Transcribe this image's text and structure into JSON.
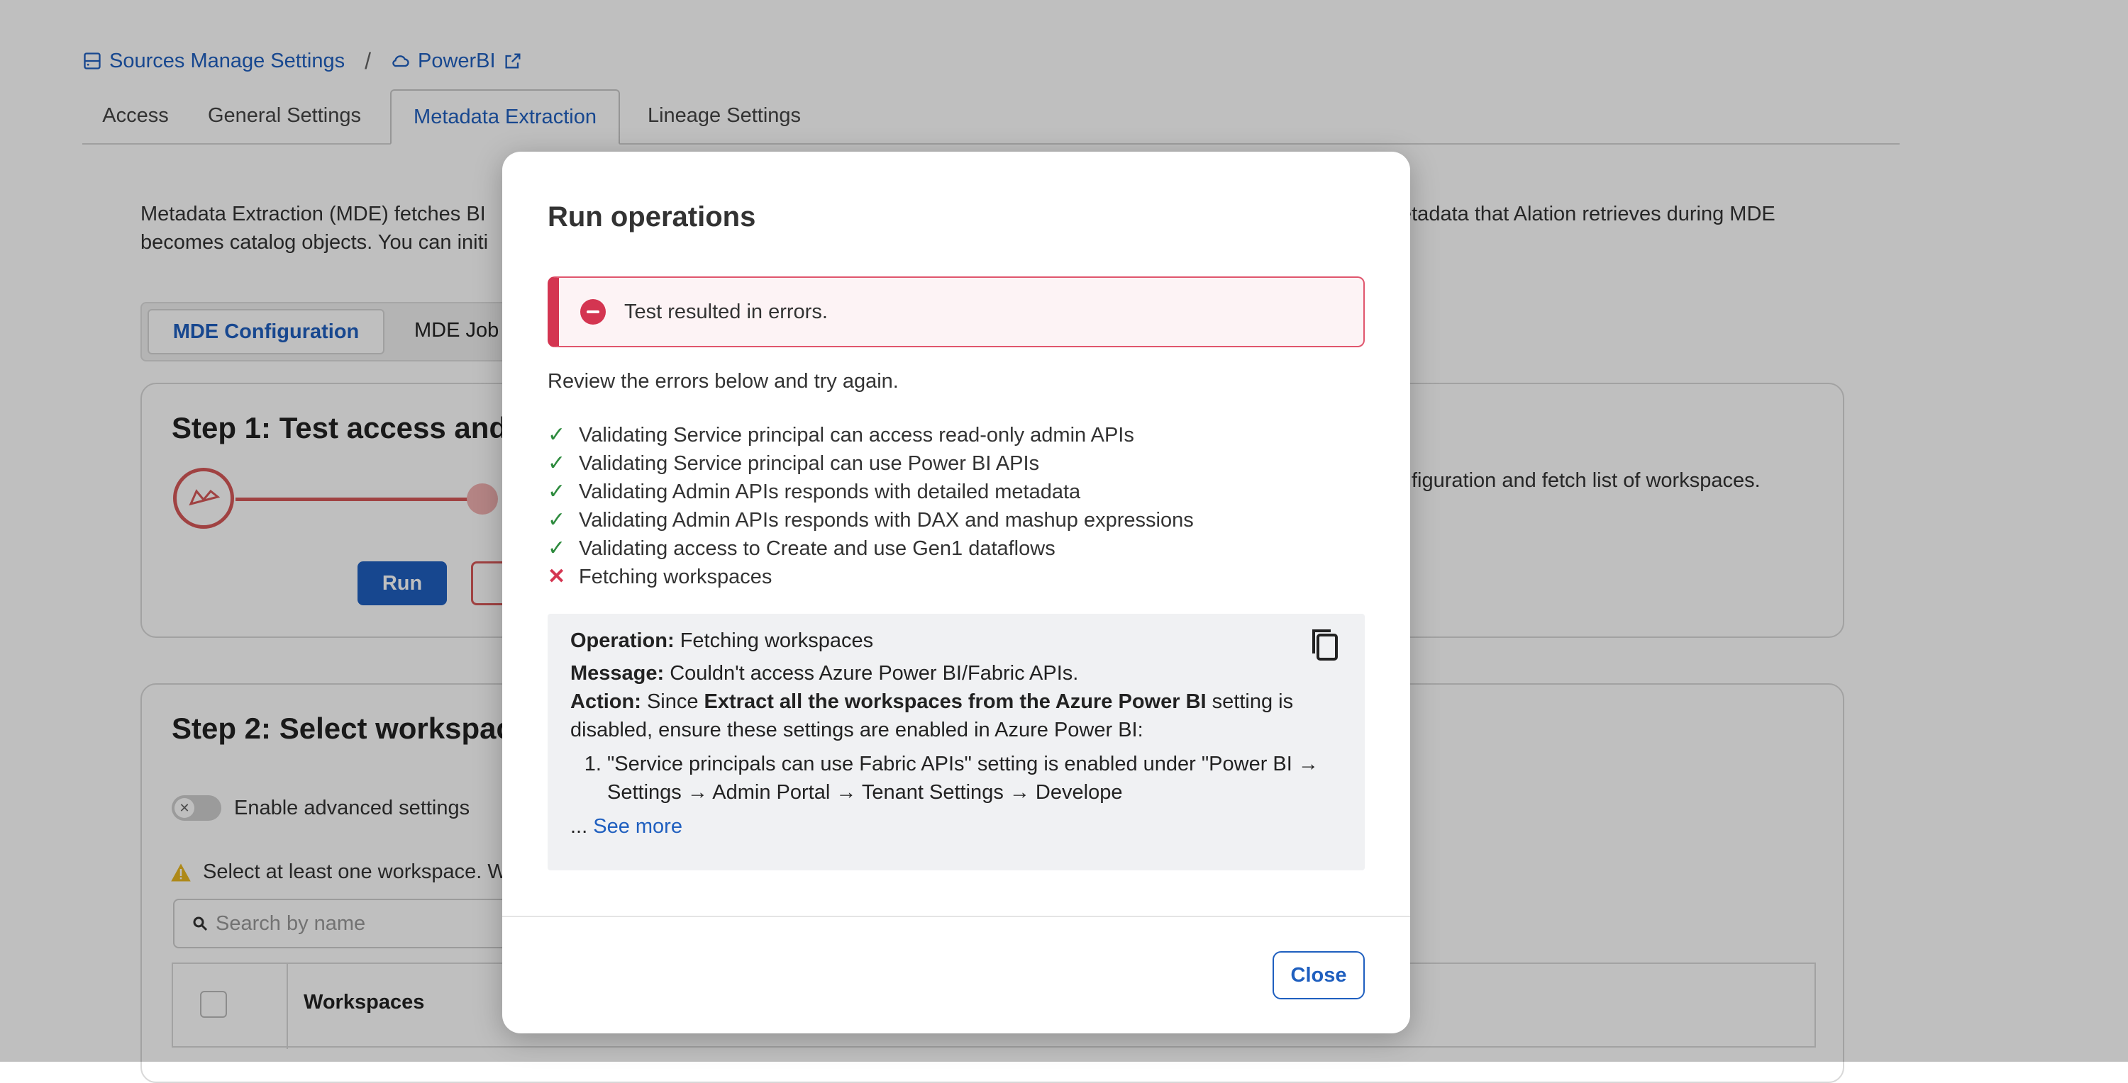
{
  "breadcrumb": {
    "sources_label": "Sources Manage Settings",
    "separator": "/",
    "source_label": "PowerBI"
  },
  "tabs": [
    "Access",
    "General Settings",
    "Metadata Extraction",
    "Lineage Settings"
  ],
  "active_tab": "Metadata Extraction",
  "intro": {
    "line1_left": "Metadata Extraction (MDE) fetches BI",
    "line1_right": "etadata that Alation retrieves during MDE",
    "line2": "becomes catalog objects. You can initi"
  },
  "subtabs": [
    "MDE Configuration",
    "MDE Job"
  ],
  "step1": {
    "title": "Step 1: Test access and",
    "run_label": "Run",
    "right_text": "figuration and fetch list of workspaces."
  },
  "step2": {
    "title": "Step 2: Select workspac",
    "toggle_label": "Enable advanced settings",
    "warning": "Select at least one workspace. W",
    "search_placeholder": "Search by name",
    "column_header": "Workspaces"
  },
  "modal": {
    "title": "Run operations",
    "alert_text": "Test resulted in errors.",
    "review_text": "Review the errors below and try again.",
    "checks": [
      {
        "status": "ok",
        "text": "Validating Service principal can access read-only admin APIs"
      },
      {
        "status": "ok",
        "text": "Validating Service principal can use Power BI APIs"
      },
      {
        "status": "ok",
        "text": "Validating Admin APIs responds with detailed metadata"
      },
      {
        "status": "ok",
        "text": "Validating Admin APIs responds with DAX and mashup expressions"
      },
      {
        "status": "ok",
        "text": "Validating access to Create and use Gen1 dataflows"
      },
      {
        "status": "fail",
        "text": "Fetching workspaces"
      }
    ],
    "error": {
      "operation_label": "Operation:",
      "operation_value": "Fetching workspaces",
      "message_label": "Message:",
      "message_value": "Couldn't access Azure Power BI/Fabric APIs.",
      "action_label": "Action:",
      "action_prefix": "Since",
      "action_bold": "Extract all the workspaces from the Azure Power BI",
      "action_suffix": "setting is disabled, ensure these settings are enabled in Azure Power BI:",
      "list_item": "\"Service principals can use Fabric APIs\" setting is enabled under \"Power BI → Settings → Admin Portal → Tenant Settings → Develope",
      "ellipsis": "...",
      "see_more": "See more"
    },
    "close_label": "Close"
  },
  "colors": {
    "accent": "#1f5fbf",
    "error": "#d43551",
    "success": "#2e8b3e"
  }
}
